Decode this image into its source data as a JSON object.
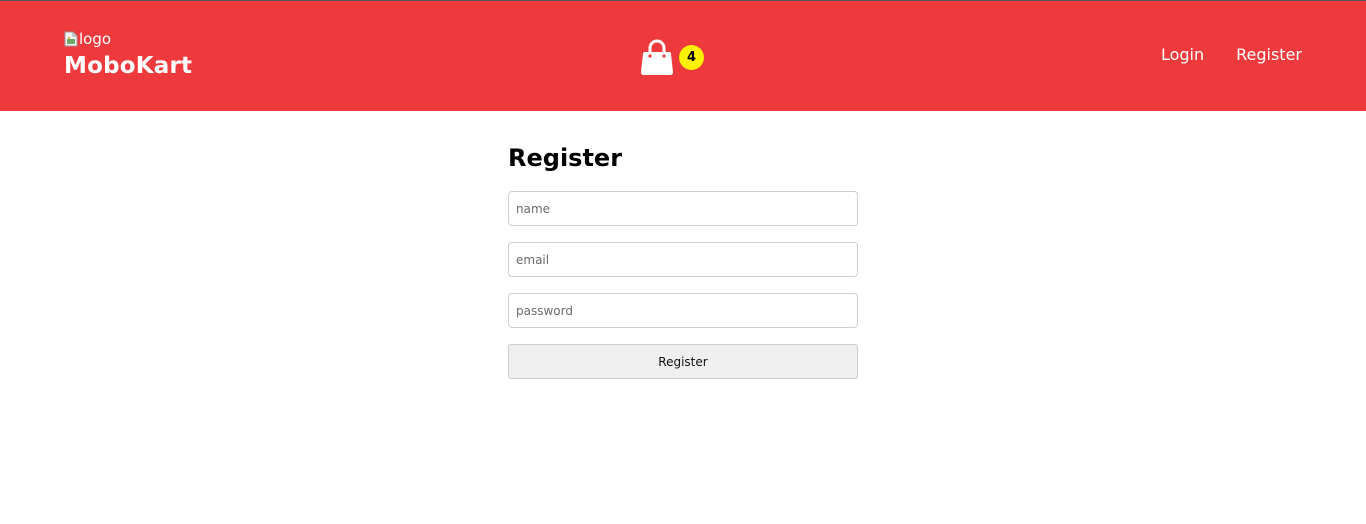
{
  "header": {
    "logo_alt": "logo",
    "brand_name": "MoboKart",
    "cart_icon": "shopping-bag-icon",
    "cart_count": "4",
    "nav": [
      {
        "label": "Login"
      },
      {
        "label": "Register"
      }
    ]
  },
  "form": {
    "title": "Register",
    "name_placeholder": "name",
    "email_placeholder": "email",
    "password_placeholder": "password",
    "submit_label": "Register"
  },
  "colors": {
    "header_bg": "#ee3a3d",
    "badge_bg": "#fff200",
    "button_bg": "#efefef"
  }
}
